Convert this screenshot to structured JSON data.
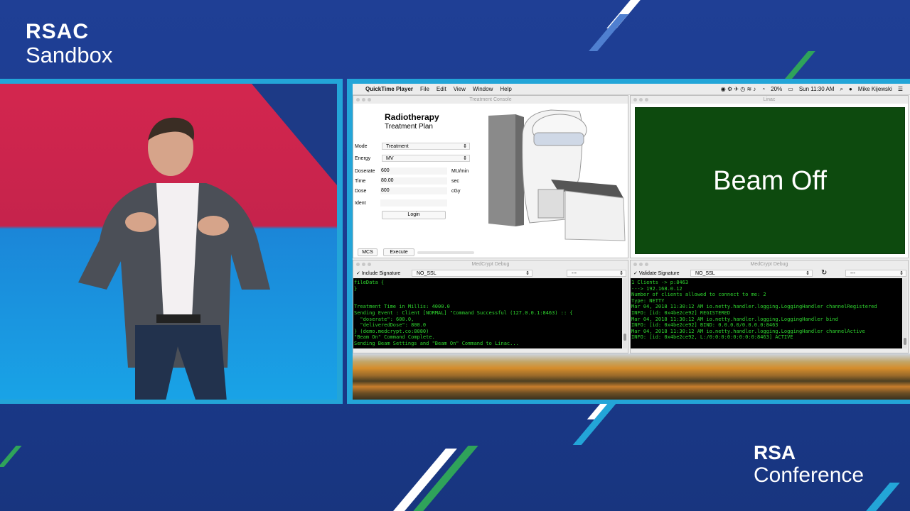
{
  "branding": {
    "sandbox_line1": "RSAC",
    "sandbox_line2": "Sandbox",
    "conference_line1": "RSA",
    "conference_line2": "Conference"
  },
  "colors": {
    "bg": "#1d3f93",
    "frame": "#23a5d8",
    "stripe_green": "#2fa35a",
    "beam_panel": "#0d4a0e",
    "console_text": "#2fd62f"
  },
  "menubar": {
    "app": "QuickTime Player",
    "items": [
      "File",
      "Edit",
      "View",
      "Window",
      "Help"
    ],
    "battery": "20%",
    "time": "Sun 11:30 AM",
    "user": "Mike Kijewski"
  },
  "treatment_console": {
    "window_title": "Treatment Console",
    "title": "Radiotherapy",
    "subtitle": "Treatment Plan",
    "mode_label": "Mode",
    "mode_value": "Treatment",
    "energy_label": "Energy",
    "energy_value": "MV",
    "doserate_label": "Doserate",
    "doserate_value": "600",
    "doserate_unit": "MU/min",
    "time_label": "Time",
    "time_value": "80.00",
    "time_unit": "sec",
    "dose_label": "Dose",
    "dose_value": "800",
    "dose_unit": "cGy",
    "ident_label": "Ident",
    "ident_value": "",
    "login_button": "Login",
    "mcs_button": "MCS",
    "execute_button": "Execute"
  },
  "linac": {
    "window_title": "Linac",
    "status": "Beam Off"
  },
  "debug_left": {
    "window_title": "MedCrypt Debug",
    "checkbox_label": "Include Signature",
    "ssl_select": "NO_SSL",
    "second_select": "---",
    "log": "fileData {\n}\n\n\nTreatment Time in Millis: 4000.0\nSending Event : Client [NORMAL] \"Command Successful (127.0.0.1:8463) :: {\n  \"doserate\": 600.0,\n  \"deliveredDose\": 800.0\n} (demo.medcrypt.co:8080)\n\"Beam On\" Command Complete.\nSending Beam Settings and \"Beam On\" Command to Linac..."
  },
  "debug_right": {
    "window_title": "MedCrypt Debug",
    "checkbox_label": "Validate Signature",
    "ssl_select": "NO_SSL",
    "second_select": "---",
    "log": "1 Clients -> p:8463\n---> 192.168.0.12\nNumber of clients allowed to connect to me: 2\nType: NETTY\nMar 04, 2018 11:30:12 AM io.netty.handler.logging.LoggingHandler channelRegistered\nINFO: [id: 0x4be2ce92] REGISTERED\nMar 04, 2018 11:30:12 AM io.netty.handler.logging.LoggingHandler bind\nINFO: [id: 0x4be2ce92] BIND: 0.0.0.0/0.0.0.0:8463\nMar 04, 2018 11:30:12 AM io.netty.handler.logging.LoggingHandler channelActive\nINFO: [id: 0x4be2ce92, L:/0:0:0:0:0:0:0:0:8463] ACTIVE"
  }
}
